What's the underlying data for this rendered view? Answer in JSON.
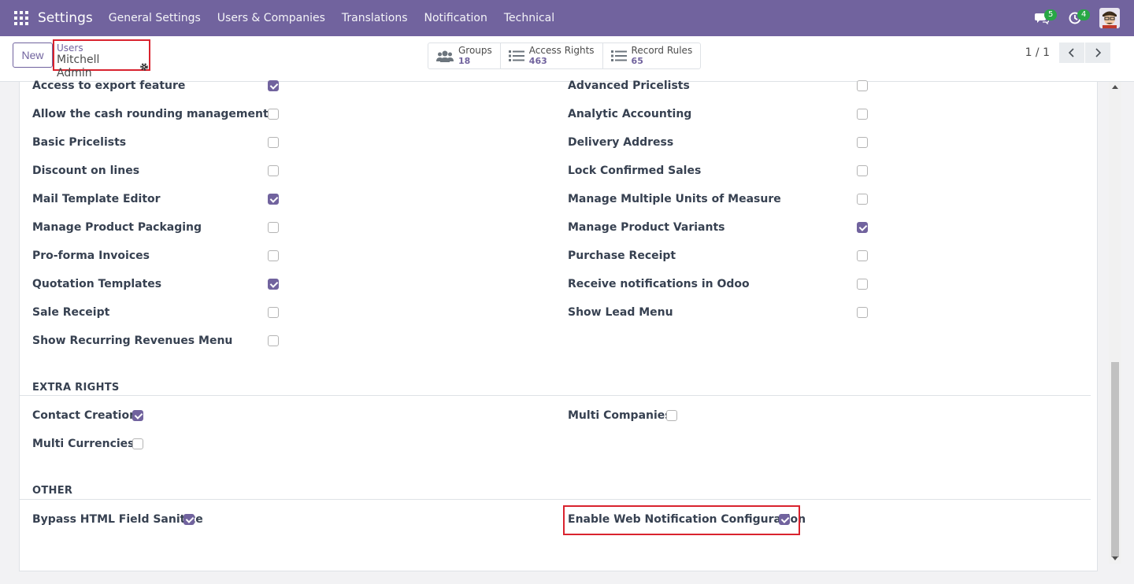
{
  "navbar": {
    "brand": "Settings",
    "menu": [
      "General Settings",
      "Users & Companies",
      "Translations",
      "Notification",
      "Technical"
    ],
    "messages_count": "5",
    "activities_count": "4"
  },
  "control_panel": {
    "new_label": "New",
    "breadcrumb_parent": "Users",
    "breadcrumb_current": "Mitchell Admin",
    "smart_buttons": [
      {
        "label": "Groups",
        "value": "18",
        "icon": "users-icon"
      },
      {
        "label": "Access Rights",
        "value": "463",
        "icon": "list-icon"
      },
      {
        "label": "Record Rules",
        "value": "65",
        "icon": "list-icon"
      }
    ],
    "pager": "1 / 1"
  },
  "technical_left": [
    {
      "label": "Access to export feature",
      "checked": true
    },
    {
      "label": "Allow the cash rounding management",
      "checked": false
    },
    {
      "label": "Basic Pricelists",
      "checked": false
    },
    {
      "label": "Discount on lines",
      "checked": false
    },
    {
      "label": "Mail Template Editor",
      "checked": true
    },
    {
      "label": "Manage Product Packaging",
      "checked": false
    },
    {
      "label": "Pro-forma Invoices",
      "checked": false
    },
    {
      "label": "Quotation Templates",
      "checked": true
    },
    {
      "label": "Sale Receipt",
      "checked": false
    },
    {
      "label": "Show Recurring Revenues Menu",
      "checked": false
    }
  ],
  "technical_right": [
    {
      "label": "Advanced Pricelists",
      "checked": false
    },
    {
      "label": "Analytic Accounting",
      "checked": false
    },
    {
      "label": "Delivery Address",
      "checked": false
    },
    {
      "label": "Lock Confirmed Sales",
      "checked": false
    },
    {
      "label": "Manage Multiple Units of Measure",
      "checked": false
    },
    {
      "label": "Manage Product Variants",
      "checked": true
    },
    {
      "label": "Purchase Receipt",
      "checked": false
    },
    {
      "label": "Receive notifications in Odoo",
      "checked": false
    },
    {
      "label": "Show Lead Menu",
      "checked": false
    }
  ],
  "extra_rights": {
    "title": "EXTRA RIGHTS",
    "left": [
      {
        "label": "Contact Creation",
        "checked": true
      },
      {
        "label": "Multi Currencies",
        "checked": false
      }
    ],
    "right": [
      {
        "label": "Multi Companies",
        "checked": false
      }
    ]
  },
  "other": {
    "title": "OTHER",
    "left": [
      {
        "label": "Bypass HTML Field Sanitize",
        "checked": true
      }
    ],
    "right": [
      {
        "label": "Enable Web Notification Configuration",
        "checked": true
      }
    ]
  },
  "colors": {
    "navbar": "#71639e",
    "accent": "#71639e",
    "highlight": "#d9232e",
    "badge": "#28a745"
  }
}
